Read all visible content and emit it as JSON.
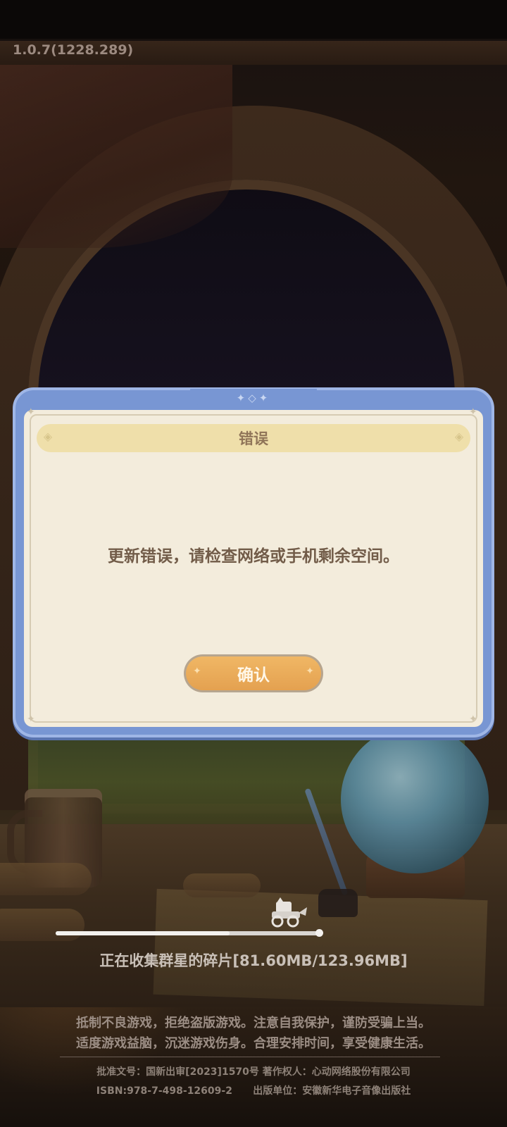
{
  "version": "1.0.7(1228.289)",
  "dialog": {
    "title": "错误",
    "message": "更新错误，请检查网络或手机剩余空间。",
    "confirm_label": "确认"
  },
  "loading": {
    "progress_text": "正在收集群星的碎片[81.60MB/123.96MB]",
    "progress_fraction": 0.658,
    "progress_icon": "cart-icon"
  },
  "footer": {
    "warning_line1": "抵制不良游戏，拒绝盗版游戏。注意自我保护，谨防受骗上当。",
    "warning_line2": "适度游戏益脑，沉迷游戏伤身。合理安排时间，享受健康生活。",
    "approval": "批准文号：国新出审[2023]1570号  著作权人：心动网络股份有限公司",
    "isbn_publisher": "ISBN:978-7-498-12609-2      出版单位：安徽新华电子音像出版社"
  },
  "colors": {
    "dialog_frame": "#7896d3",
    "dialog_panel": "#f3ecdc",
    "title_bar": "#efdfaa",
    "confirm_button": "#e4a150",
    "text_brown": "#725c49"
  }
}
